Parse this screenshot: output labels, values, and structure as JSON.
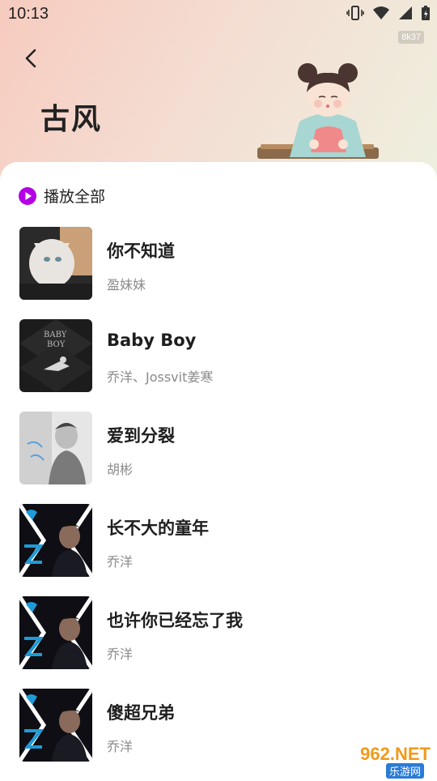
{
  "status_bar": {
    "time": "10:13",
    "badge": "8k37"
  },
  "header": {
    "title": "古风"
  },
  "play_all": {
    "label": "播放全部"
  },
  "songs": [
    {
      "title": "你不知道",
      "artist": "盈妹妹"
    },
    {
      "title": "Baby Boy",
      "artist": "乔洋、Jossvit姜寒"
    },
    {
      "title": "爱到分裂",
      "artist": "胡彬"
    },
    {
      "title": "长不大的童年",
      "artist": "乔洋"
    },
    {
      "title": "也许你已经忘了我",
      "artist": "乔洋"
    },
    {
      "title": "傻超兄弟",
      "artist": "乔洋"
    }
  ],
  "watermark": {
    "main": "962.NET",
    "sub": "乐游网"
  },
  "colors": {
    "accent": "#b400e6",
    "title": "#222222",
    "artist": "#8a8a8a"
  }
}
